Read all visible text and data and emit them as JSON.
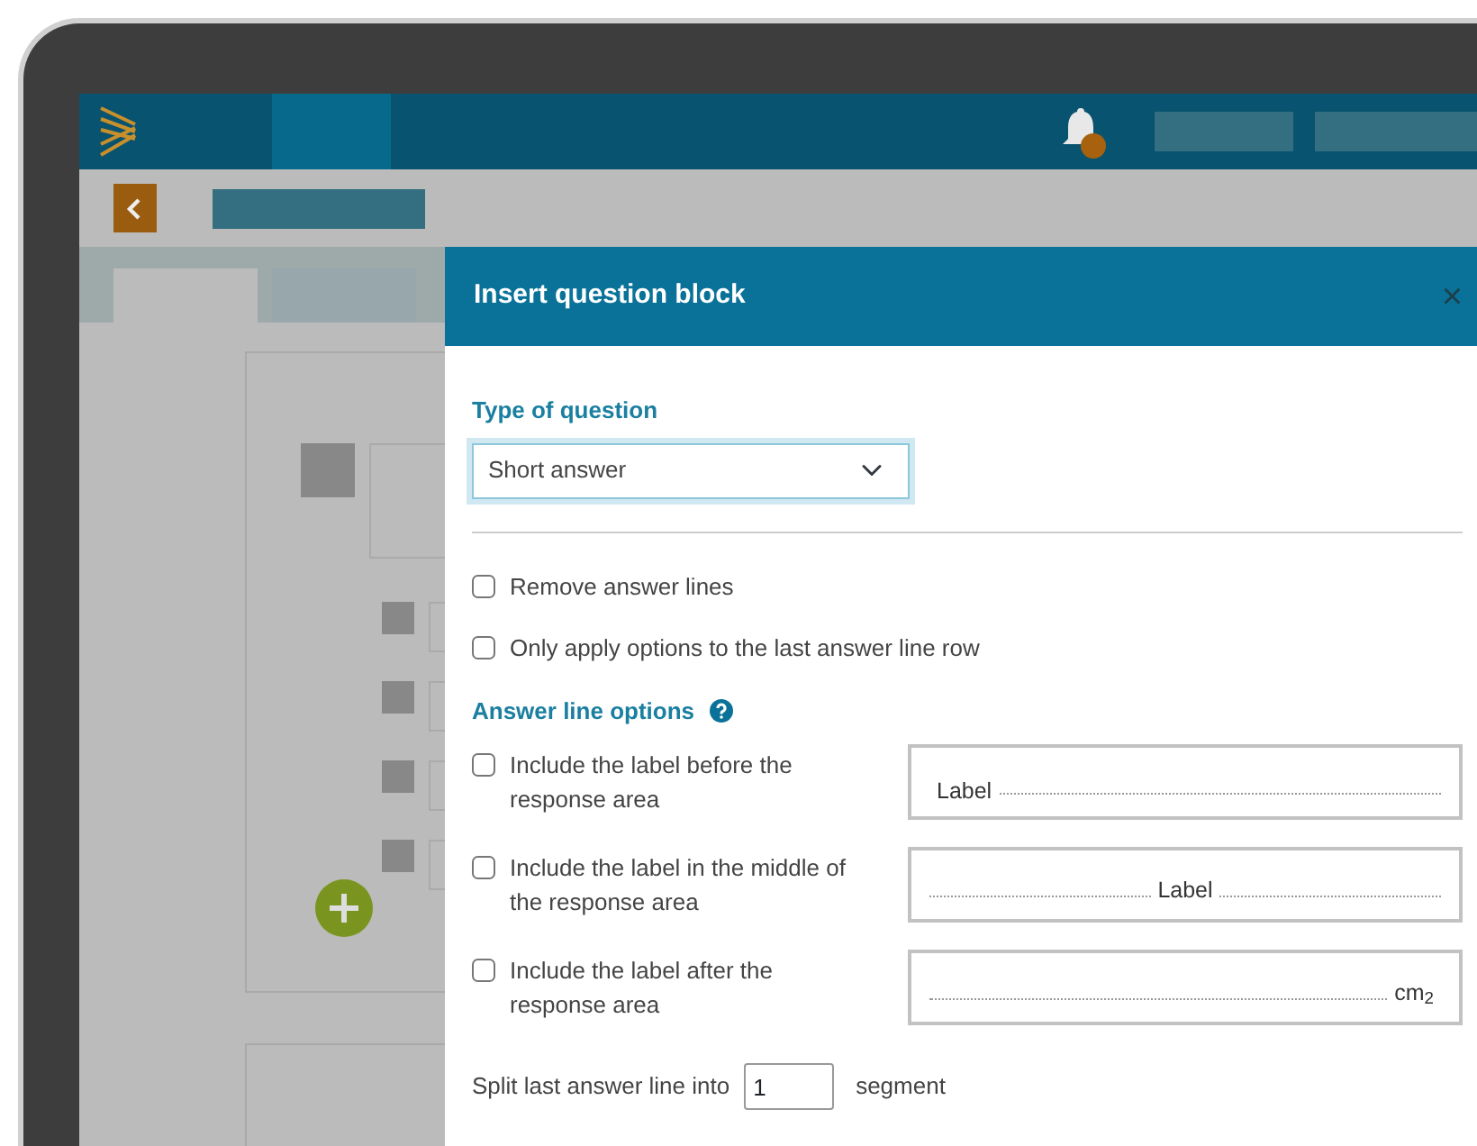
{
  "dialog": {
    "title": "Insert question block",
    "close": "×"
  },
  "type_of_question": {
    "label": "Type of question",
    "value": "Short answer"
  },
  "options": [
    {
      "label": "Remove answer lines",
      "checked": false
    },
    {
      "label": "Only apply options to the last answer line row",
      "checked": false
    }
  ],
  "answer_line_options": {
    "heading": "Answer line options",
    "items": [
      {
        "label": "Include the label before the response area",
        "checked": false,
        "kind": "before",
        "preview": "Label"
      },
      {
        "label": "Include the label in the middle of the response area",
        "checked": false,
        "kind": "middle",
        "preview": "Label"
      },
      {
        "label": "Include the label after the response area",
        "checked": false,
        "kind": "after",
        "preview": "cm$_{2}$"
      }
    ]
  },
  "split": {
    "before": "Split last answer line into",
    "value": "1",
    "after": "segment"
  }
}
